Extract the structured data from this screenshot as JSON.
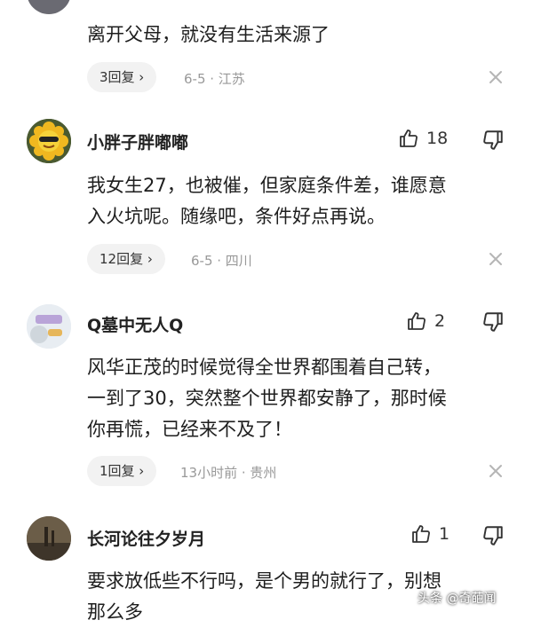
{
  "comments": [
    {
      "text": "离开父母，就没有生活来源了",
      "reply_label": "3回复 ›",
      "meta": "6-5 · 江苏"
    },
    {
      "username": "小胖子胖嘟嘟",
      "likes": "18",
      "text_lines": [
        "我女生27，也被催，但家庭条件差，谁愿意",
        "入火坑呢。随缘吧，条件好点再说。"
      ],
      "reply_label": "12回复 ›",
      "meta": "6-5 · 四川"
    },
    {
      "username": "Q墓中无人Q",
      "likes": "2",
      "text_lines": [
        "风华正茂的时候觉得全世界都围着自己转，",
        "一到了30，突然整个世界都安静了，那时候",
        "你再慌，已经来不及了！"
      ],
      "reply_label": "1回复 ›",
      "meta": "13小时前 · 贵州"
    },
    {
      "username": "长河论往夕岁月",
      "likes": "1",
      "text_lines": [
        "要求放低些不行吗，是个男的就行了，别想",
        "那么多"
      ]
    }
  ],
  "watermark": "头条 @奇葩闻",
  "colors": {
    "pill_bg": "#f2f2f2",
    "meta": "#999999",
    "text": "#1e1e1e"
  }
}
